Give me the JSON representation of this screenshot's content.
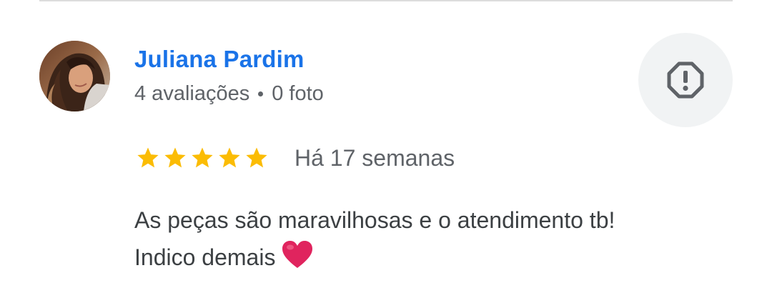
{
  "review": {
    "reviewer_name": "Juliana Pardim",
    "reviews_count": "4 avaliações",
    "photos_count": "0 foto",
    "rating": 5,
    "rating_max": 5,
    "time_ago": "Há 17 semanas",
    "text_line1": "As peças são maravilhosas e o atendimento tb!",
    "text_line2": "Indico demais",
    "emoji_icon": "red-heart-icon"
  },
  "icons": {
    "report": "flag-octagon-exclamation-icon",
    "star": "star-icon"
  },
  "colors": {
    "name_link": "#1a73e8",
    "meta_text": "#5f6368",
    "body_text": "#3c4043",
    "star": "#fbbc04",
    "button_bg": "#f1f3f4",
    "heart": "#e0245e"
  }
}
